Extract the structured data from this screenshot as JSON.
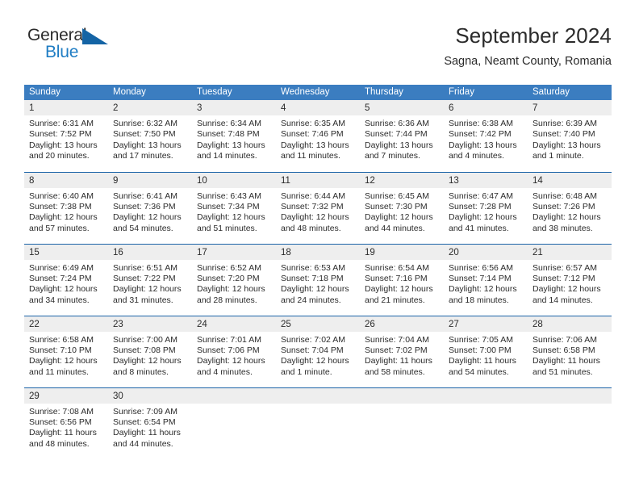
{
  "brand": {
    "name_part1": "General",
    "name_part2": "Blue",
    "triangle_icon": "blue-triangle-icon",
    "accent_color": "#1464a5",
    "text_color": "#1f7dc4"
  },
  "header": {
    "title": "September 2024",
    "subtitle": "Sagna, Neamt County, Romania"
  },
  "calendar": {
    "header_bg": "#3b7dc0",
    "header_text_color": "#ffffff",
    "row_divider_color": "#1c64a8",
    "daynum_bg": "#eeeeee",
    "weekdays": [
      "Sunday",
      "Monday",
      "Tuesday",
      "Wednesday",
      "Thursday",
      "Friday",
      "Saturday"
    ],
    "weeks": [
      [
        {
          "day": "1",
          "sunrise": "Sunrise: 6:31 AM",
          "sunset": "Sunset: 7:52 PM",
          "daylight_line1": "Daylight: 13 hours",
          "daylight_line2": "and 20 minutes."
        },
        {
          "day": "2",
          "sunrise": "Sunrise: 6:32 AM",
          "sunset": "Sunset: 7:50 PM",
          "daylight_line1": "Daylight: 13 hours",
          "daylight_line2": "and 17 minutes."
        },
        {
          "day": "3",
          "sunrise": "Sunrise: 6:34 AM",
          "sunset": "Sunset: 7:48 PM",
          "daylight_line1": "Daylight: 13 hours",
          "daylight_line2": "and 14 minutes."
        },
        {
          "day": "4",
          "sunrise": "Sunrise: 6:35 AM",
          "sunset": "Sunset: 7:46 PM",
          "daylight_line1": "Daylight: 13 hours",
          "daylight_line2": "and 11 minutes."
        },
        {
          "day": "5",
          "sunrise": "Sunrise: 6:36 AM",
          "sunset": "Sunset: 7:44 PM",
          "daylight_line1": "Daylight: 13 hours",
          "daylight_line2": "and 7 minutes."
        },
        {
          "day": "6",
          "sunrise": "Sunrise: 6:38 AM",
          "sunset": "Sunset: 7:42 PM",
          "daylight_line1": "Daylight: 13 hours",
          "daylight_line2": "and 4 minutes."
        },
        {
          "day": "7",
          "sunrise": "Sunrise: 6:39 AM",
          "sunset": "Sunset: 7:40 PM",
          "daylight_line1": "Daylight: 13 hours",
          "daylight_line2": "and 1 minute."
        }
      ],
      [
        {
          "day": "8",
          "sunrise": "Sunrise: 6:40 AM",
          "sunset": "Sunset: 7:38 PM",
          "daylight_line1": "Daylight: 12 hours",
          "daylight_line2": "and 57 minutes."
        },
        {
          "day": "9",
          "sunrise": "Sunrise: 6:41 AM",
          "sunset": "Sunset: 7:36 PM",
          "daylight_line1": "Daylight: 12 hours",
          "daylight_line2": "and 54 minutes."
        },
        {
          "day": "10",
          "sunrise": "Sunrise: 6:43 AM",
          "sunset": "Sunset: 7:34 PM",
          "daylight_line1": "Daylight: 12 hours",
          "daylight_line2": "and 51 minutes."
        },
        {
          "day": "11",
          "sunrise": "Sunrise: 6:44 AM",
          "sunset": "Sunset: 7:32 PM",
          "daylight_line1": "Daylight: 12 hours",
          "daylight_line2": "and 48 minutes."
        },
        {
          "day": "12",
          "sunrise": "Sunrise: 6:45 AM",
          "sunset": "Sunset: 7:30 PM",
          "daylight_line1": "Daylight: 12 hours",
          "daylight_line2": "and 44 minutes."
        },
        {
          "day": "13",
          "sunrise": "Sunrise: 6:47 AM",
          "sunset": "Sunset: 7:28 PM",
          "daylight_line1": "Daylight: 12 hours",
          "daylight_line2": "and 41 minutes."
        },
        {
          "day": "14",
          "sunrise": "Sunrise: 6:48 AM",
          "sunset": "Sunset: 7:26 PM",
          "daylight_line1": "Daylight: 12 hours",
          "daylight_line2": "and 38 minutes."
        }
      ],
      [
        {
          "day": "15",
          "sunrise": "Sunrise: 6:49 AM",
          "sunset": "Sunset: 7:24 PM",
          "daylight_line1": "Daylight: 12 hours",
          "daylight_line2": "and 34 minutes."
        },
        {
          "day": "16",
          "sunrise": "Sunrise: 6:51 AM",
          "sunset": "Sunset: 7:22 PM",
          "daylight_line1": "Daylight: 12 hours",
          "daylight_line2": "and 31 minutes."
        },
        {
          "day": "17",
          "sunrise": "Sunrise: 6:52 AM",
          "sunset": "Sunset: 7:20 PM",
          "daylight_line1": "Daylight: 12 hours",
          "daylight_line2": "and 28 minutes."
        },
        {
          "day": "18",
          "sunrise": "Sunrise: 6:53 AM",
          "sunset": "Sunset: 7:18 PM",
          "daylight_line1": "Daylight: 12 hours",
          "daylight_line2": "and 24 minutes."
        },
        {
          "day": "19",
          "sunrise": "Sunrise: 6:54 AM",
          "sunset": "Sunset: 7:16 PM",
          "daylight_line1": "Daylight: 12 hours",
          "daylight_line2": "and 21 minutes."
        },
        {
          "day": "20",
          "sunrise": "Sunrise: 6:56 AM",
          "sunset": "Sunset: 7:14 PM",
          "daylight_line1": "Daylight: 12 hours",
          "daylight_line2": "and 18 minutes."
        },
        {
          "day": "21",
          "sunrise": "Sunrise: 6:57 AM",
          "sunset": "Sunset: 7:12 PM",
          "daylight_line1": "Daylight: 12 hours",
          "daylight_line2": "and 14 minutes."
        }
      ],
      [
        {
          "day": "22",
          "sunrise": "Sunrise: 6:58 AM",
          "sunset": "Sunset: 7:10 PM",
          "daylight_line1": "Daylight: 12 hours",
          "daylight_line2": "and 11 minutes."
        },
        {
          "day": "23",
          "sunrise": "Sunrise: 7:00 AM",
          "sunset": "Sunset: 7:08 PM",
          "daylight_line1": "Daylight: 12 hours",
          "daylight_line2": "and 8 minutes."
        },
        {
          "day": "24",
          "sunrise": "Sunrise: 7:01 AM",
          "sunset": "Sunset: 7:06 PM",
          "daylight_line1": "Daylight: 12 hours",
          "daylight_line2": "and 4 minutes."
        },
        {
          "day": "25",
          "sunrise": "Sunrise: 7:02 AM",
          "sunset": "Sunset: 7:04 PM",
          "daylight_line1": "Daylight: 12 hours",
          "daylight_line2": "and 1 minute."
        },
        {
          "day": "26",
          "sunrise": "Sunrise: 7:04 AM",
          "sunset": "Sunset: 7:02 PM",
          "daylight_line1": "Daylight: 11 hours",
          "daylight_line2": "and 58 minutes."
        },
        {
          "day": "27",
          "sunrise": "Sunrise: 7:05 AM",
          "sunset": "Sunset: 7:00 PM",
          "daylight_line1": "Daylight: 11 hours",
          "daylight_line2": "and 54 minutes."
        },
        {
          "day": "28",
          "sunrise": "Sunrise: 7:06 AM",
          "sunset": "Sunset: 6:58 PM",
          "daylight_line1": "Daylight: 11 hours",
          "daylight_line2": "and 51 minutes."
        }
      ],
      [
        {
          "day": "29",
          "sunrise": "Sunrise: 7:08 AM",
          "sunset": "Sunset: 6:56 PM",
          "daylight_line1": "Daylight: 11 hours",
          "daylight_line2": "and 48 minutes."
        },
        {
          "day": "30",
          "sunrise": "Sunrise: 7:09 AM",
          "sunset": "Sunset: 6:54 PM",
          "daylight_line1": "Daylight: 11 hours",
          "daylight_line2": "and 44 minutes."
        },
        {
          "day": "",
          "sunrise": "",
          "sunset": "",
          "daylight_line1": "",
          "daylight_line2": ""
        },
        {
          "day": "",
          "sunrise": "",
          "sunset": "",
          "daylight_line1": "",
          "daylight_line2": ""
        },
        {
          "day": "",
          "sunrise": "",
          "sunset": "",
          "daylight_line1": "",
          "daylight_line2": ""
        },
        {
          "day": "",
          "sunrise": "",
          "sunset": "",
          "daylight_line1": "",
          "daylight_line2": ""
        },
        {
          "day": "",
          "sunrise": "",
          "sunset": "",
          "daylight_line1": "",
          "daylight_line2": ""
        }
      ]
    ]
  }
}
